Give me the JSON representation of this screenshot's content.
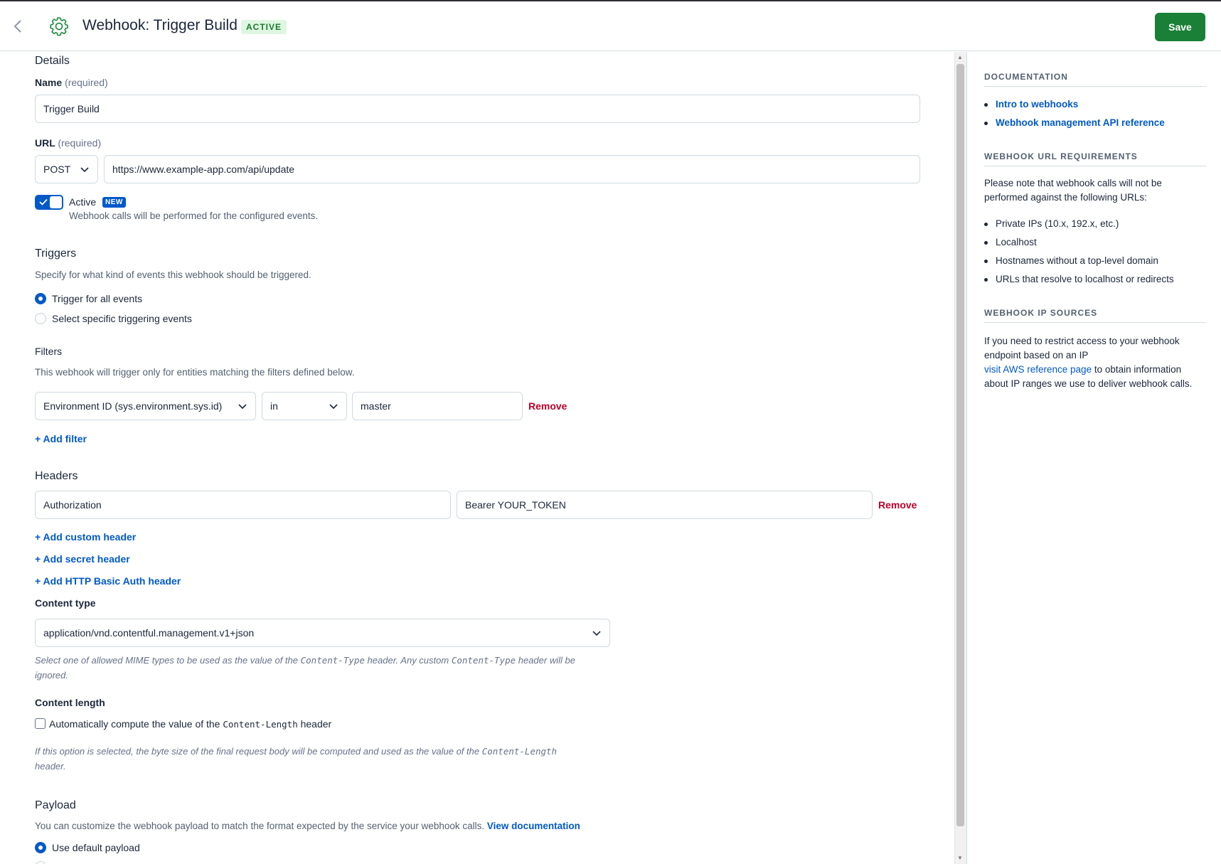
{
  "header": {
    "title": "Webhook: Trigger Build",
    "status_badge": "ACTIVE",
    "save_label": "Save"
  },
  "details": {
    "section_title": "Details",
    "name_label": "Name",
    "name_required": "(required)",
    "name_value": "Trigger Build",
    "url_label": "URL",
    "url_required": "(required)",
    "method": "POST",
    "url_value": "https://www.example-app.com/api/update",
    "active_label": "Active",
    "active_on": true,
    "new_badge": "NEW",
    "active_help": "Webhook calls will be performed for the configured events."
  },
  "triggers": {
    "section_title": "Triggers",
    "description": "Specify for what kind of events this webhook should be triggered.",
    "options": [
      {
        "label": "Trigger for all events",
        "selected": true
      },
      {
        "label": "Select specific triggering events",
        "selected": false
      }
    ]
  },
  "filters": {
    "title": "Filters",
    "description": "This webhook will trigger only for entities matching the filters defined below.",
    "rows": [
      {
        "field": "Environment ID (sys.environment.sys.id)",
        "operator": "in",
        "value": "master",
        "remove_label": "Remove"
      }
    ],
    "add_filter_label": "+ Add filter"
  },
  "headers": {
    "section_title": "Headers",
    "rows": [
      {
        "key": "Authorization",
        "value": "Bearer YOUR_TOKEN",
        "remove_label": "Remove"
      }
    ],
    "add_custom_label": "+ Add custom header",
    "add_secret_label": "+ Add secret header",
    "add_basic_auth_label": "+ Add HTTP Basic Auth header"
  },
  "content_type": {
    "label": "Content type",
    "value": "application/vnd.contentful.management.v1+json",
    "help_part1": "Select one of allowed MIME types to be used as the value of the ",
    "help_code1": "Content-Type",
    "help_part2": " header. Any custom ",
    "help_code2": "Content-Type",
    "help_part3": " header will be",
    "help_part4": "ignored."
  },
  "content_length": {
    "label": "Content length",
    "checked": false,
    "checkbox_text1": "Automatically compute the value of the ",
    "checkbox_code": "Content-Length",
    "checkbox_text2": " header",
    "help_part1": "If this option is selected, the byte size of the final request body will be computed and used as the value of the ",
    "help_code": "Content-Length",
    "help_part2": "header."
  },
  "payload": {
    "section_title": "Payload",
    "description": "You can customize the webhook payload to match the format expected by the service your webhook calls.",
    "doc_link": "View documentation",
    "options": [
      {
        "label": "Use default payload",
        "selected": true
      }
    ]
  },
  "sidebar": {
    "documentation_title": "DOCUMENTATION",
    "doc_links": [
      "Intro to webhooks",
      "Webhook management API reference"
    ],
    "url_req_title": "WEBHOOK URL REQUIREMENTS",
    "url_req_intro": "Please note that webhook calls will not be performed against the following URLs:",
    "url_req_items": [
      "Private IPs (10.x, 192.x, etc.)",
      "Localhost",
      "Hostnames without a top-level domain",
      "URLs that resolve to localhost or redirects"
    ],
    "ip_title": "WEBHOOK IP SOURCES",
    "ip_text1": "If you need to restrict access to your webhook endpoint based on an IP",
    "ip_link": "visit AWS reference page",
    "ip_text2": " to obtain information about IP ranges we use to deliver webhook calls."
  },
  "colors": {
    "primary": "#0059c8",
    "save": "#1a7f37",
    "danger": "#bd002a",
    "active_badge_bg": "#dff7e1"
  }
}
